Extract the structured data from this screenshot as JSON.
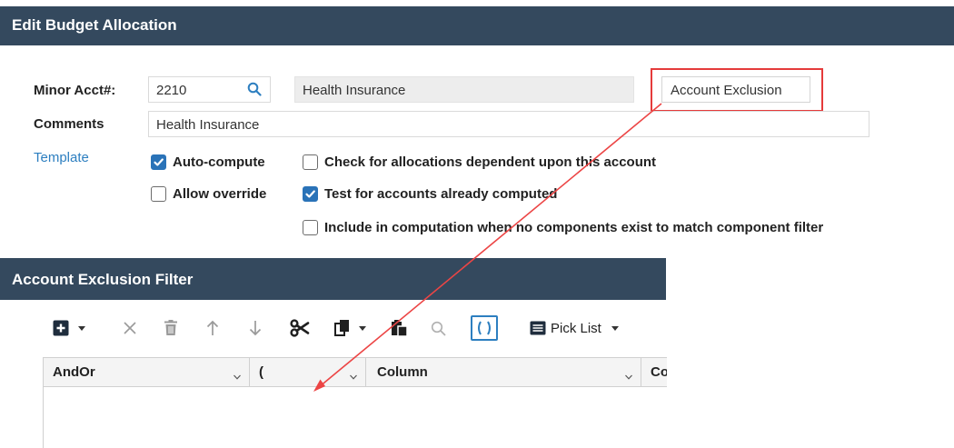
{
  "window": {
    "title": "Edit Budget Allocation"
  },
  "form": {
    "minor_acct_label": "Minor Acct#:",
    "minor_acct_value": "2210",
    "minor_acct_desc": "Health Insurance",
    "account_exclusion_button": "Account Exclusion",
    "comments_label": "Comments",
    "comments_value": "Health Insurance",
    "template_link": "Template"
  },
  "checkboxes": [
    {
      "label": "Auto-compute",
      "checked": true
    },
    {
      "label": "Check for allocations dependent upon this account",
      "checked": false
    },
    {
      "label": "Allow override",
      "checked": false
    },
    {
      "label": "Test for accounts already computed",
      "checked": true
    },
    {
      "label": "Include in computation when no components exist to match component filter",
      "checked": false
    }
  ],
  "filter_panel": {
    "title": "Account Exclusion Filter",
    "toolbar": {
      "pick_list_label": "Pick List"
    },
    "columns": [
      {
        "label": "AndOr"
      },
      {
        "label": "("
      },
      {
        "label": "Column"
      },
      {
        "label": "Co"
      }
    ]
  },
  "colors": {
    "header_bg": "#34495e",
    "checkbox_checked": "#2a73b8",
    "link": "#2d7fc0",
    "highlight": "#e53b3b"
  },
  "icons": [
    "search-icon",
    "add-icon",
    "delete-icon",
    "trash-icon",
    "arrow-up-icon",
    "arrow-down-icon",
    "scissors-icon",
    "copy-icon",
    "paste-icon",
    "search-icon",
    "parentheses-icon",
    "pick-list-icon",
    "chevron-down-icon"
  ]
}
